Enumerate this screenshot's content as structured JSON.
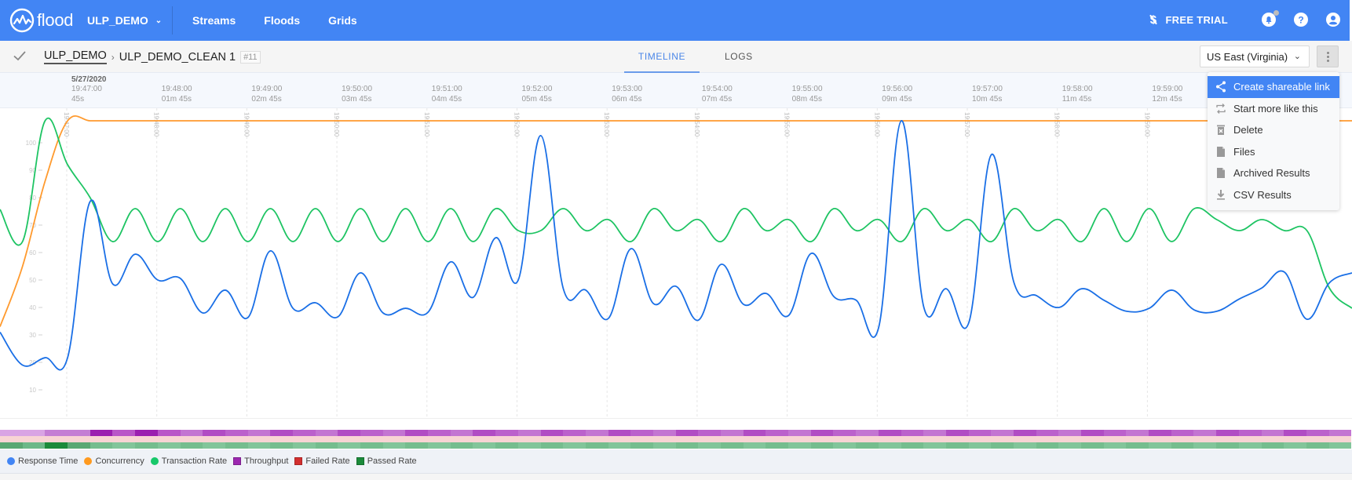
{
  "header": {
    "logo_text": "flood",
    "org": "ULP_DEMO",
    "nav": [
      "Streams",
      "Floods",
      "Grids"
    ],
    "free_trial": "FREE TRIAL",
    "icons": [
      "dollar-off-icon",
      "bell-icon",
      "help-icon",
      "user-icon"
    ]
  },
  "subheader": {
    "breadcrumb_root": "ULP_DEMO",
    "breadcrumb_current": "ULP_DEMO_CLEAN 1",
    "run_number": "#11",
    "tabs": [
      {
        "label": "TIMELINE",
        "active": true
      },
      {
        "label": "LOGS",
        "active": false
      }
    ],
    "region": "US East (Virginia)"
  },
  "menu": {
    "items": [
      {
        "label": "Create shareable link",
        "icon": "share-icon",
        "active": true
      },
      {
        "label": "Start more like this",
        "icon": "repeat-icon",
        "active": false
      },
      {
        "label": "Delete",
        "icon": "trash-icon",
        "active": false
      },
      {
        "label": "Files",
        "icon": "file-icon",
        "active": false
      },
      {
        "label": "Archived Results",
        "icon": "file-icon",
        "active": false
      },
      {
        "label": "CSV Results",
        "icon": "download-icon",
        "active": false
      }
    ]
  },
  "timeline": {
    "date": "5/27/2020",
    "columns": [
      {
        "time": "19:47:00",
        "elapsed": "45s"
      },
      {
        "time": "19:48:00",
        "elapsed": "01m 45s"
      },
      {
        "time": "19:49:00",
        "elapsed": "02m 45s"
      },
      {
        "time": "19:50:00",
        "elapsed": "03m 45s"
      },
      {
        "time": "19:51:00",
        "elapsed": "04m 45s"
      },
      {
        "time": "19:52:00",
        "elapsed": "05m 45s"
      },
      {
        "time": "19:53:00",
        "elapsed": "06m 45s"
      },
      {
        "time": "19:54:00",
        "elapsed": "07m 45s"
      },
      {
        "time": "19:55:00",
        "elapsed": "08m 45s"
      },
      {
        "time": "19:56:00",
        "elapsed": "09m 45s"
      },
      {
        "time": "19:57:00",
        "elapsed": "10m 45s"
      },
      {
        "time": "19:58:00",
        "elapsed": "11m 45s"
      },
      {
        "time": "19:59:00",
        "elapsed": "12m 45s"
      }
    ]
  },
  "legend": [
    {
      "label": "Response Time",
      "shape": "dot",
      "color": "#4285f4"
    },
    {
      "label": "Concurrency",
      "shape": "dot",
      "color": "#ff9a1f"
    },
    {
      "label": "Transaction Rate",
      "shape": "dot",
      "color": "#17c86a"
    },
    {
      "label": "Throughput",
      "shape": "square",
      "color": "#9c27b0"
    },
    {
      "label": "Failed Rate",
      "shape": "square",
      "color": "#d32f2f"
    },
    {
      "label": "Passed Rate",
      "shape": "square",
      "color": "#1b8a3a"
    }
  ],
  "chart_data": {
    "type": "line",
    "title": "",
    "xlabel": "",
    "ylabel": "",
    "x_start": "19:46:45",
    "x_step_seconds": 15,
    "x_tick_labels": [
      "19:47:00",
      "19:48:00",
      "19:49:00",
      "19:50:00",
      "19:51:00",
      "19:52:00",
      "19:53:00",
      "19:54:00",
      "19:55:00",
      "19:56:00",
      "19:57:00",
      "19:58:00",
      "19:59:00"
    ],
    "y_ticks": [
      10,
      20,
      30,
      40,
      50,
      60,
      70,
      80,
      90,
      100
    ],
    "ylim": [
      0,
      112
    ],
    "grid": "vertical-dashed",
    "legend_position": "bottom-left",
    "series": [
      {
        "name": "Response Time",
        "color": "#1a6fe6",
        "values": [
          31,
          19,
          21.7,
          21.7,
          78.6,
          48.6,
          59.4,
          50,
          50.6,
          38,
          46.3,
          36.3,
          60.6,
          39.7,
          41.7,
          36.6,
          52.6,
          38,
          39.7,
          38.3,
          56.6,
          43.7,
          65.4,
          50,
          102.6,
          46.8,
          46.3,
          36,
          61.4,
          41.4,
          47.7,
          35.4,
          55.7,
          41.1,
          45.1,
          37.1,
          59.7,
          44,
          42.6,
          32.9,
          108,
          40,
          46.8,
          34.6,
          95.7,
          49,
          44.3,
          40,
          46.8,
          42.6,
          38.6,
          39.7,
          46.3,
          39.1,
          38.6,
          43.1,
          47.1,
          52.9,
          35.7,
          49,
          52.6
        ]
      },
      {
        "name": "Concurrency",
        "color": "#ff9a2e",
        "values": [
          33,
          55,
          86,
          108,
          108,
          108,
          108,
          108,
          108,
          108,
          108,
          108,
          108,
          108,
          108,
          108,
          108,
          108,
          108,
          108,
          108,
          108,
          108,
          108,
          108,
          108,
          108,
          108,
          108,
          108,
          108,
          108,
          108,
          108,
          108,
          108,
          108,
          108,
          108,
          108,
          108,
          108,
          108,
          108,
          108,
          108,
          108,
          108,
          108,
          108,
          108,
          108,
          108,
          108,
          108,
          108,
          108,
          108,
          108,
          108,
          108
        ]
      },
      {
        "name": "Transaction Rate",
        "color": "#1ec463",
        "values": [
          75.7,
          64,
          108,
          92,
          80,
          64,
          76,
          64,
          76,
          64,
          76,
          64,
          76,
          64,
          76,
          64,
          76,
          64,
          76,
          64,
          76,
          64,
          76,
          68,
          68,
          76,
          68,
          72,
          64,
          76,
          68,
          72,
          64,
          76,
          68,
          72,
          64,
          76,
          68,
          72,
          64,
          76,
          68,
          72,
          64,
          76,
          68,
          72,
          64,
          76,
          64,
          76,
          64,
          76,
          72,
          68,
          72,
          68,
          68,
          47,
          39.7
        ]
      }
    ],
    "heatmap_rows": [
      {
        "name": "Throughput",
        "color": "#9c27b0"
      },
      {
        "name": "Failed Rate",
        "color": "#f8d4d4"
      },
      {
        "name": "Passed Rate",
        "color": "#1b8a3a"
      }
    ]
  }
}
